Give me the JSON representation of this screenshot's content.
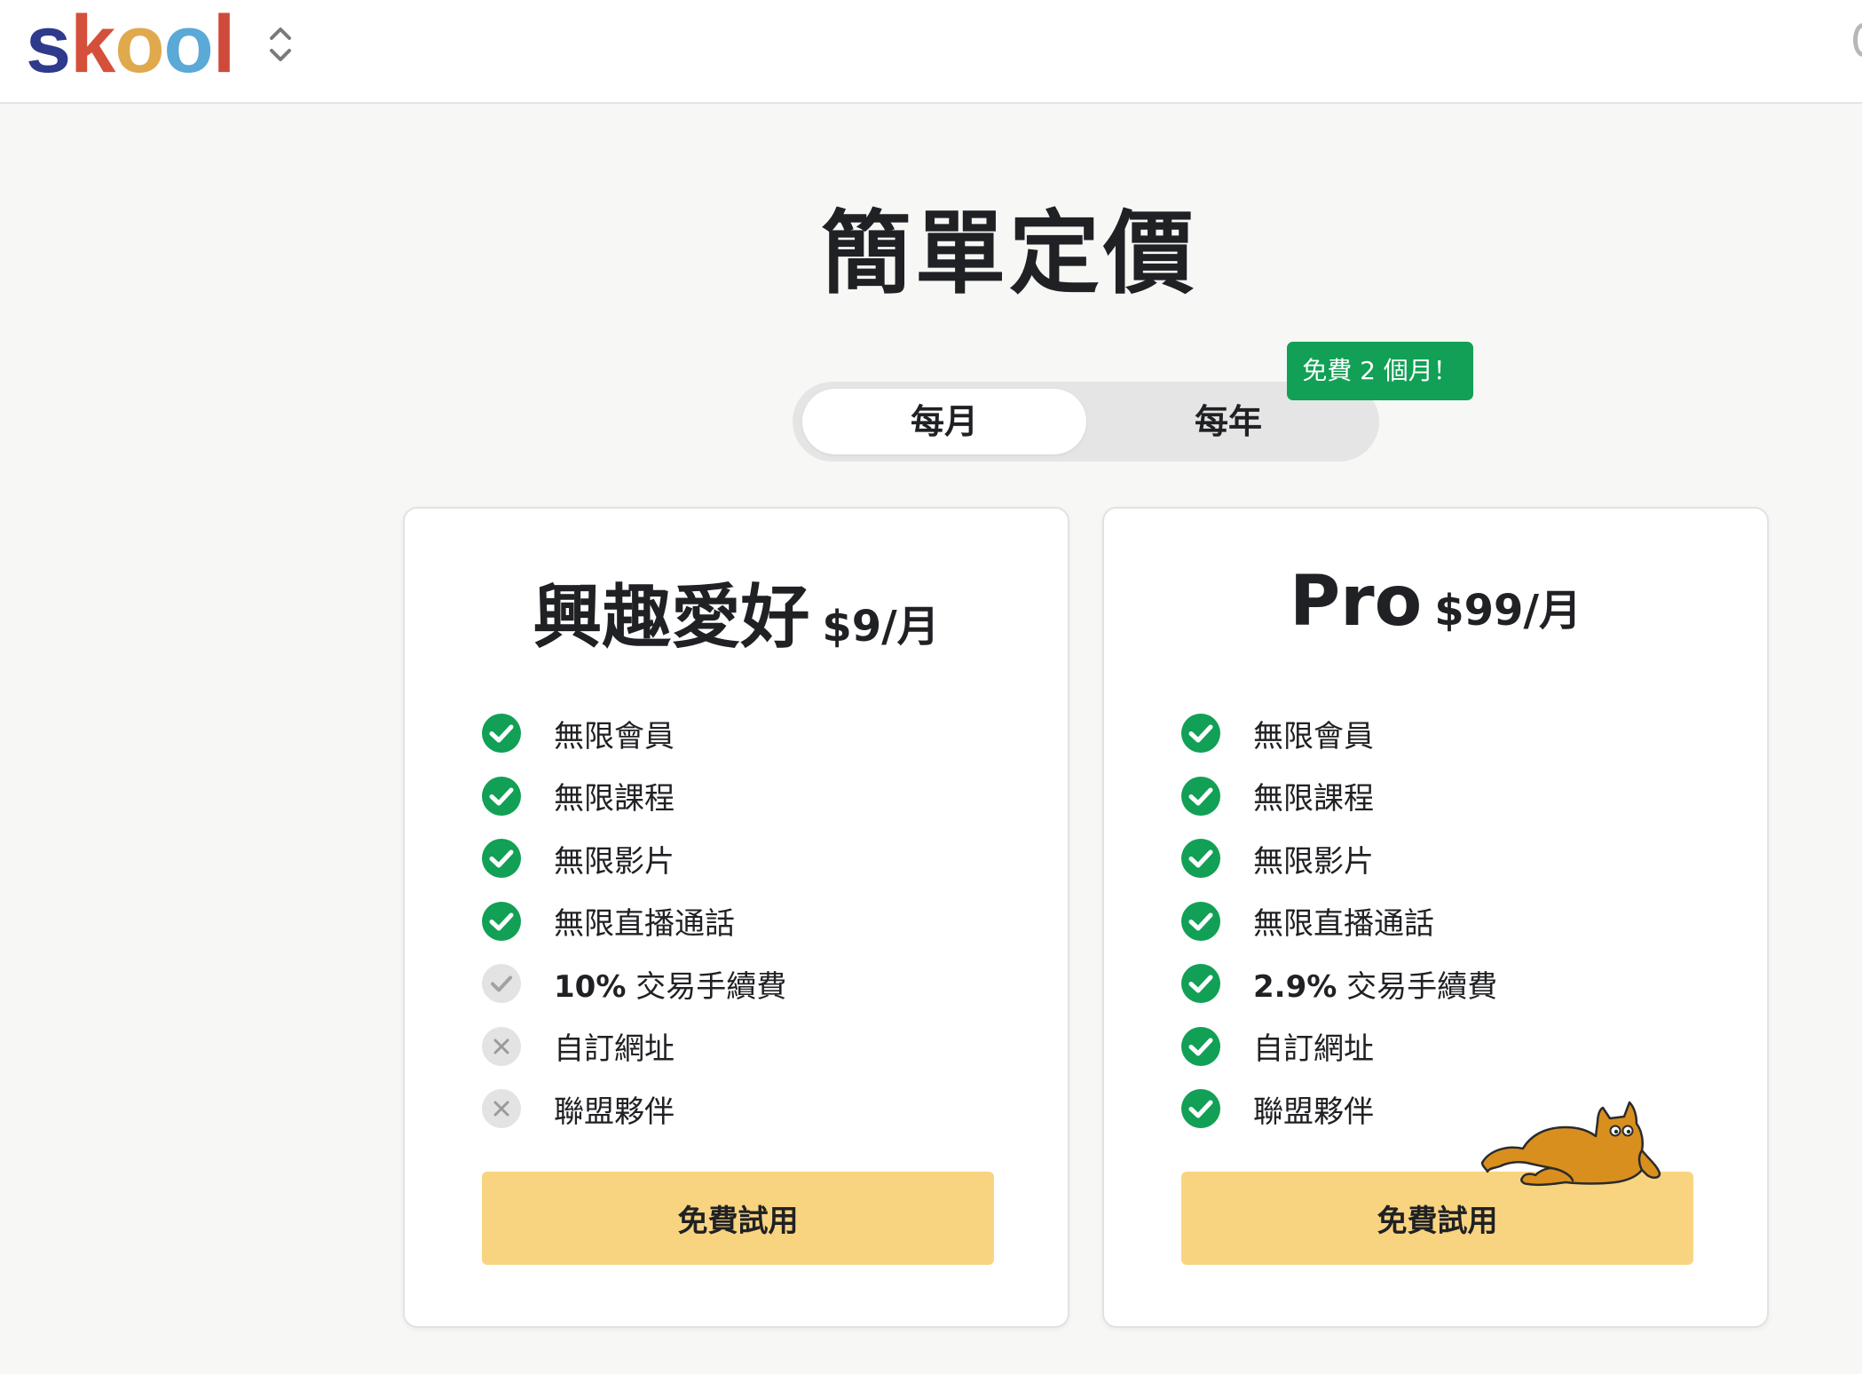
{
  "header": {
    "logo": [
      "s",
      "k",
      "o",
      "o",
      "l"
    ],
    "logo_colors": [
      "#2e3a8c",
      "#d5503a",
      "#e0a94c",
      "#5aa9d6",
      "#cf4a3b"
    ]
  },
  "page": {
    "title": "簡單定價"
  },
  "billing_toggle": {
    "monthly_label": "每月",
    "yearly_label": "每年",
    "selected": "monthly",
    "promo_badge": "免費 2 個月！"
  },
  "plans": [
    {
      "name": "興趣愛好",
      "price": "$9/月",
      "features": [
        {
          "text": "無限會員",
          "status": "included"
        },
        {
          "text": "無限課程",
          "status": "included"
        },
        {
          "text": "無限影片",
          "status": "included"
        },
        {
          "text": "無限直播通話",
          "status": "included"
        },
        {
          "bold": "10%",
          "text": " 交易手續費",
          "status": "partial"
        },
        {
          "text": "自訂網址",
          "status": "excluded"
        },
        {
          "text": "聯盟夥伴",
          "status": "excluded"
        }
      ],
      "cta_label": "免費試用"
    },
    {
      "name": "Pro",
      "price": "$99/月",
      "features": [
        {
          "text": "無限會員",
          "status": "included"
        },
        {
          "text": "無限課程",
          "status": "included"
        },
        {
          "text": "無限影片",
          "status": "included"
        },
        {
          "text": "無限直播通話",
          "status": "included"
        },
        {
          "bold": "2.9%",
          "text": " 交易手續費",
          "status": "included"
        },
        {
          "text": "自訂網址",
          "status": "included"
        },
        {
          "text": "聯盟夥伴",
          "status": "included"
        }
      ],
      "cta_label": "免費試用"
    }
  ],
  "colors": {
    "accent_green": "#11a055",
    "cta_yellow": "#f8d480",
    "muted_grey": "#e3e3e3"
  }
}
